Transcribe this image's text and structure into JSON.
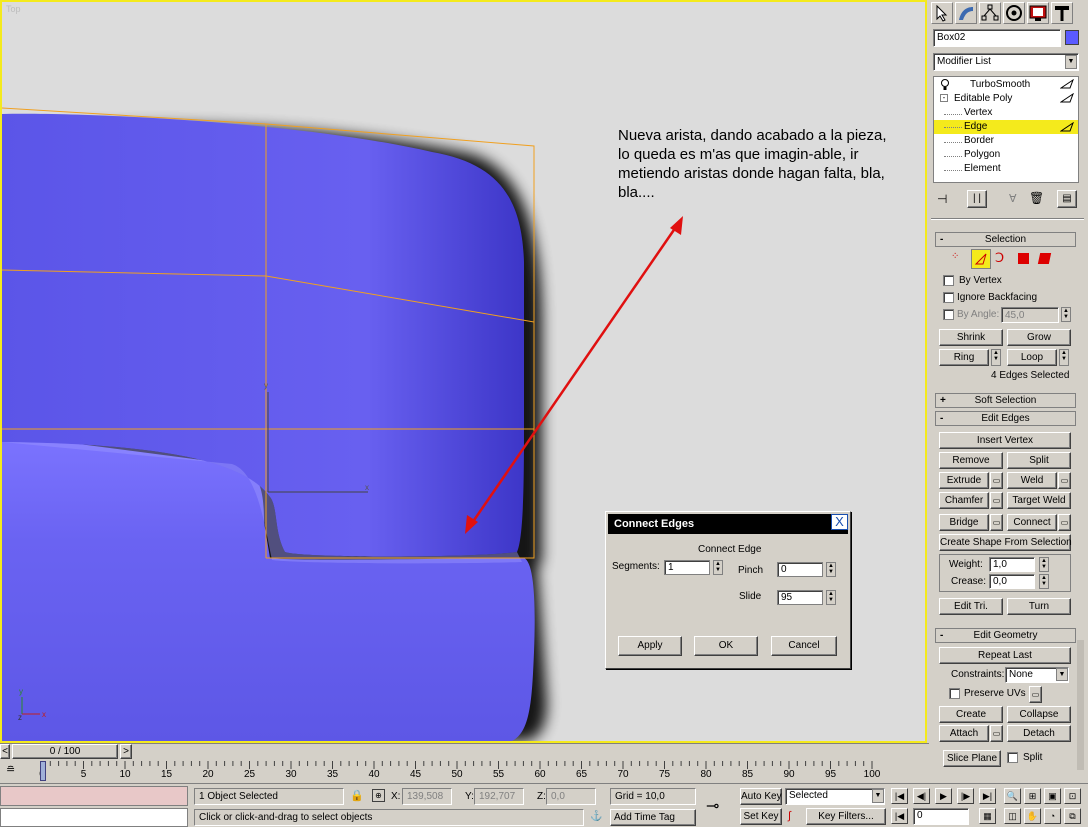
{
  "viewport": {
    "label": "Top",
    "annotation": "Nueva arista, dando acabado a la pieza, lo queda es m'as que imagin-able, ir metiendo aristas donde hagan falta, bla, bla...."
  },
  "panel": {
    "object_name": "Box02",
    "object_color": "#5a5aff",
    "modifier_list": "Modifier List",
    "stack": [
      {
        "label": "TurboSmooth"
      },
      {
        "label": "Editable Poly"
      },
      {
        "label": "Vertex"
      },
      {
        "label": "Edge"
      },
      {
        "label": "Border"
      },
      {
        "label": "Polygon"
      },
      {
        "label": "Element"
      }
    ],
    "selection": {
      "title": "Selection",
      "by_vertex": "By Vertex",
      "ignore_backfacing": "Ignore Backfacing",
      "by_angle": "By Angle:",
      "angle_value": "45,0",
      "shrink": "Shrink",
      "grow": "Grow",
      "ring": "Ring",
      "loop": "Loop",
      "status": "4 Edges Selected"
    },
    "soft_selection": {
      "title": "Soft Selection",
      "sign": "+"
    },
    "edit_edges": {
      "title": "Edit Edges",
      "sign": "-",
      "insert_vertex": "Insert Vertex",
      "remove": "Remove",
      "split": "Split",
      "extrude": "Extrude",
      "weld": "Weld",
      "chamfer": "Chamfer",
      "target_weld": "Target Weld",
      "bridge": "Bridge",
      "connect": "Connect",
      "create_shape": "Create Shape From Selection",
      "weight_label": "Weight:",
      "weight_value": "1,0",
      "crease_label": "Crease:",
      "crease_value": "0,0",
      "edit_tri": "Edit Tri.",
      "turn": "Turn"
    },
    "edit_geometry": {
      "title": "Edit Geometry",
      "sign": "-",
      "repeat_last": "Repeat Last",
      "constraints_label": "Constraints:",
      "constraints_value": "None",
      "preserve_uvs": "Preserve UVs",
      "create": "Create",
      "collapse": "Collapse",
      "attach": "Attach",
      "detach": "Detach",
      "slice_plane": "Slice Plane",
      "split": "Split"
    },
    "selection_sign": "-"
  },
  "dialog": {
    "title": "Connect Edges",
    "close_glyph": "X",
    "group_label": "Connect Edge",
    "segments_label": "Segments:",
    "segments_value": "1",
    "pinch_label": "Pinch",
    "pinch_value": "0",
    "slide_label": "Slide",
    "slide_value": "95",
    "apply": "Apply",
    "ok": "OK",
    "cancel": "Cancel"
  },
  "timeline": {
    "frame_display": "0 / 100",
    "prev": "<",
    "next": ">",
    "ticks": [
      "0",
      "5",
      "10",
      "15",
      "20",
      "25",
      "30",
      "35",
      "40",
      "45",
      "50",
      "55",
      "60",
      "65",
      "70",
      "75",
      "80",
      "85",
      "90",
      "95",
      "100"
    ]
  },
  "status": {
    "selection_info": "1 Object Selected",
    "prompt": "Click or click-and-drag to select objects",
    "x_label": "X:",
    "x_value": "139,508",
    "y_label": "Y:",
    "y_value": "192,707",
    "z_label": "Z:",
    "z_value": "0,0",
    "grid": "Grid = 10,0",
    "add_time_tag": "Add Time Tag",
    "auto_key": "Auto Key",
    "set_key": "Set Key",
    "key_mode": "Selected",
    "key_filters": "Key Filters...",
    "frame": "0"
  }
}
